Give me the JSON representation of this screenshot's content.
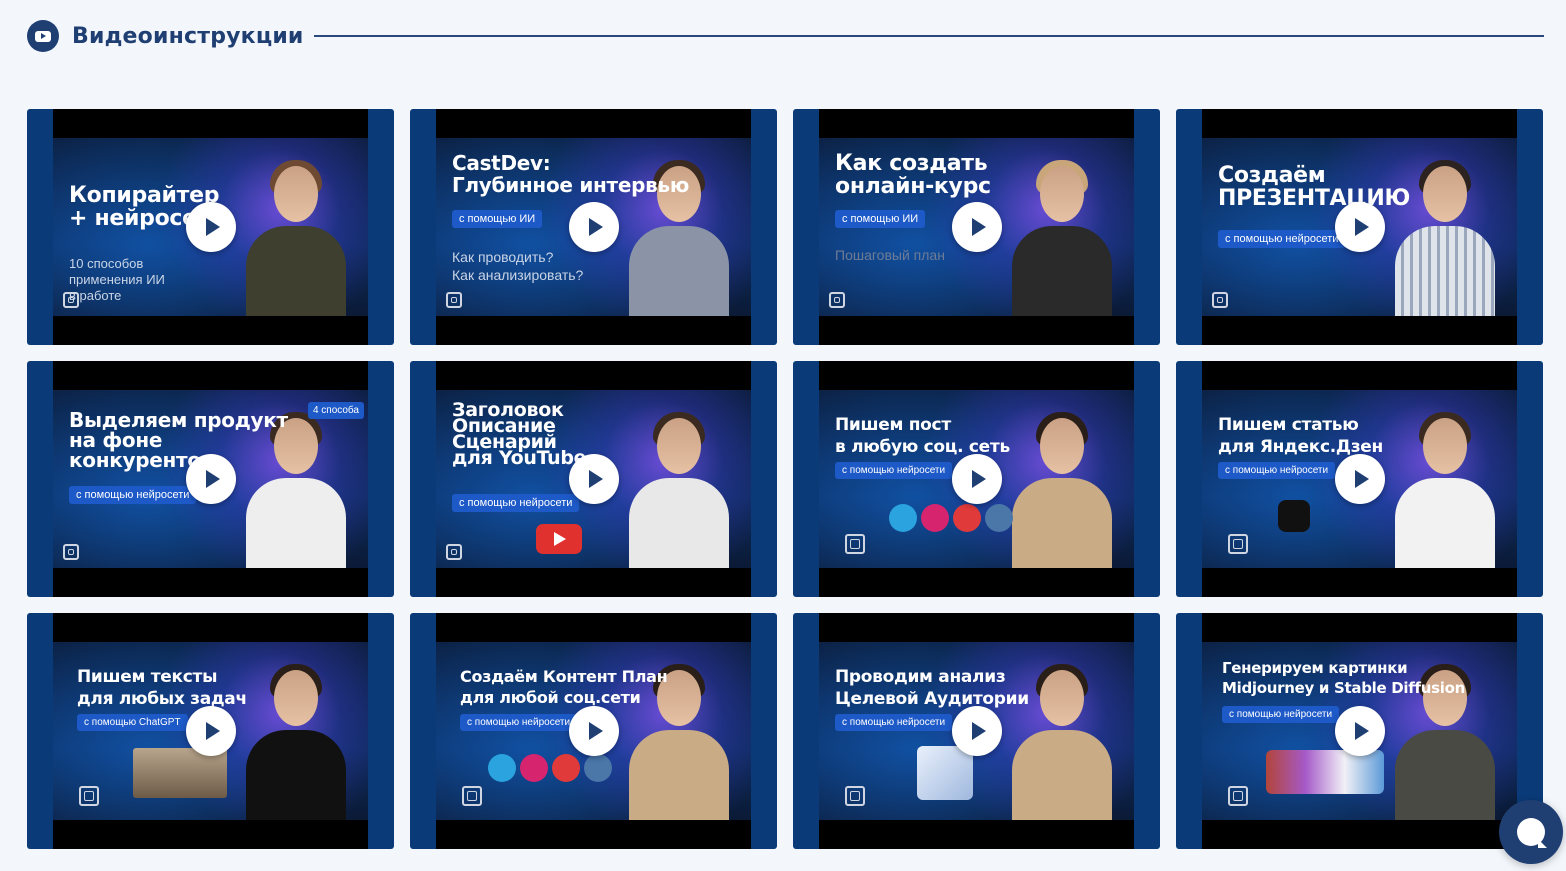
{
  "header": {
    "title": "Видеоинструкции",
    "icon": "youtube-icon"
  },
  "colors": {
    "accent": "#1f3f73",
    "background": "#f3f6fb",
    "pill": "#1d59c7"
  },
  "videos": [
    {
      "title": "Копирайтер\n+ нейросеть",
      "subtitle": "10 способов\nприменения ИИ\nв работе",
      "pill": "",
      "tag": ""
    },
    {
      "title": "CastDev:\nГлубинное интервью",
      "subtitle": "Как проводить?\nКак анализировать?",
      "pill": "с помощью ИИ",
      "tag": ""
    },
    {
      "title": "Как создать\nонлайн-курс",
      "subtitle": "Пошаговый план",
      "pill": "с помощью ИИ",
      "tag": ""
    },
    {
      "title": "Создаём\nПРЕЗЕНТАЦИЮ",
      "subtitle": "",
      "pill": "с помощью нейросети",
      "tag": ""
    },
    {
      "title": "Выделяем продукт\nна фоне\nконкурентов",
      "subtitle": "",
      "pill": "с помощью нейросети",
      "tag": "4 способа"
    },
    {
      "title": "Заголовок\nОписание\nСценарий\nдля YouTube",
      "subtitle": "",
      "pill": "с помощью нейросети",
      "tag": ""
    },
    {
      "title": "Пишем пост\nв любую соц. сеть",
      "subtitle": "",
      "pill": "с помощью нейросети",
      "tag": ""
    },
    {
      "title": "Пишем статью\nдля Яндекс.Дзен",
      "subtitle": "",
      "pill": "с помощью нейросети",
      "tag": ""
    },
    {
      "title": "Пишем тексты\nдля любых задач",
      "subtitle": "",
      "pill": "с помощью ChatGPT",
      "tag": ""
    },
    {
      "title": "Создаём Контент План\nдля любой соц.сети",
      "subtitle": "",
      "pill": "с помощью нейросети",
      "tag": ""
    },
    {
      "title": "Проводим анализ\nЦелевой Аудитории",
      "subtitle": "",
      "pill": "с помощью нейросети",
      "tag": ""
    },
    {
      "title": "Генерируем картинки\nMidjourney и Stable Diffusion",
      "subtitle": "",
      "pill": "с помощью нейросети",
      "tag": ""
    }
  ],
  "chat": {
    "icon": "chat-bubble-icon"
  }
}
